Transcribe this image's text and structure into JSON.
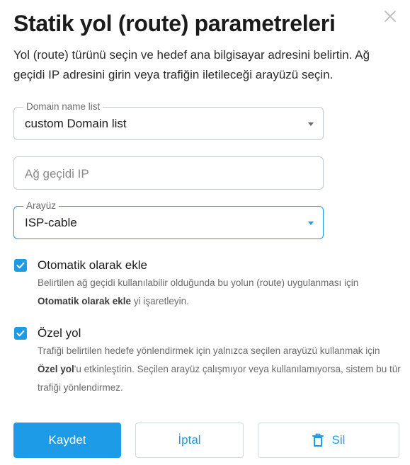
{
  "dialog": {
    "title": "Statik yol (route) parametreleri",
    "description": "Yol (route) türünü seçin ve hedef ana bilgisayar adresini belirtin. Ağ geçidi IP adresini girin veya trafiğin iletileceği arayüzü seçin.",
    "close_icon": "close-icon"
  },
  "form": {
    "domain_list": {
      "label": "Domain name list",
      "value": "custom Domain list"
    },
    "gateway_ip": {
      "placeholder": "Ağ geçidi IP",
      "value": ""
    },
    "interface": {
      "label": "Arayüz",
      "value": "ISP-cable"
    },
    "auto_add": {
      "checked": true,
      "label": "Otomatik olarak ekle",
      "help_pre": "Belirtilen ağ geçidi kullanılabilir olduğunda bu yolun (route) uygulanması için ",
      "help_bold": "Otomatik olarak ekle",
      "help_post": " yi işaretleyin."
    },
    "private_route": {
      "checked": true,
      "label": "Özel yol",
      "help_pre": "Trafiği belirtilen hedefe yönlendirmek için yalnızca seçilen arayüzü kullanmak için ",
      "help_bold": "Özel yol",
      "help_post": "'u etkinleştirin. Seçilen arayüz çalışmıyor veya kullanılamıyorsa, sistem bu tür trafiği yönlendirmez."
    }
  },
  "actions": {
    "save_label": "Kaydet",
    "cancel_label": "İptal",
    "delete_label": "Sil",
    "delete_icon": "trash-icon"
  },
  "colors": {
    "accent": "#1d9be6",
    "border": "#c3c8cd",
    "help_text": "#6a6a6a"
  }
}
